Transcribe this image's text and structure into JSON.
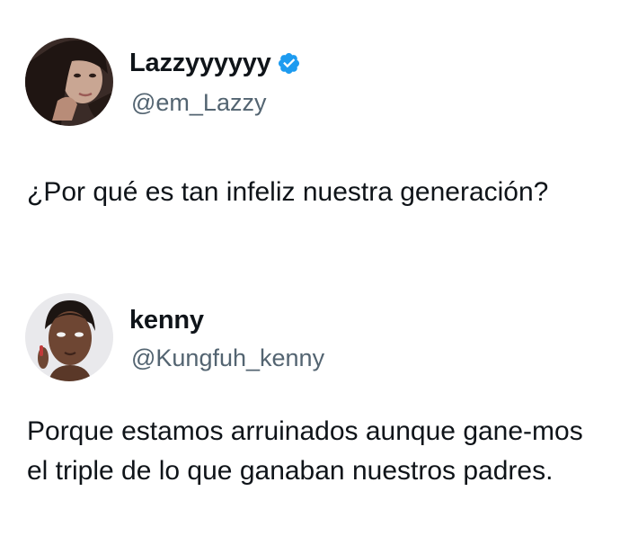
{
  "tweets": [
    {
      "display_name": "Lazzyyyyyy",
      "verified": true,
      "verified_icon": "verified-badge-icon",
      "handle": "@em_Lazzy",
      "text": "¿Por qué es tan infeliz nuestra generación?"
    },
    {
      "display_name": "kenny",
      "verified": false,
      "handle": "@Kungfuh_kenny",
      "text": "Porque estamos arruinados aunque gane-mos el triple de lo que ganaban nuestros padres."
    }
  ],
  "colors": {
    "background": "#ffffff",
    "text": "#0f1419",
    "handle": "#536471",
    "verified_badge": "#1d9bf0"
  }
}
